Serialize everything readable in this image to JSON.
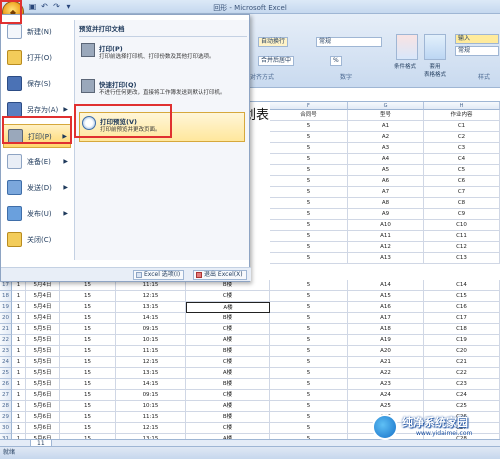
{
  "window": {
    "title": "回形 - Microsoft Excel"
  },
  "ribbon": {
    "wrap_text": "自动换行",
    "number_format": "常规",
    "merge_center": "合并后居中",
    "percent": "%",
    "group_alignment": "对齐方式",
    "group_number": "数字",
    "group_style": "样式",
    "cond_format": "条件格式",
    "table_format": "套用\n表格格式",
    "cell_style": "单元格\n样式",
    "input_label": "输入",
    "normal_label": "常规"
  },
  "menu": {
    "left_items": [
      {
        "label": "新建(N)"
      },
      {
        "label": "打开(O)"
      },
      {
        "label": "保存(S)"
      },
      {
        "label": "另存为(A)"
      },
      {
        "label": "打印(P)"
      },
      {
        "label": "准备(E)"
      },
      {
        "label": "发送(D)"
      },
      {
        "label": "发布(U)"
      },
      {
        "label": "关闭(C)"
      }
    ],
    "right_header": "预览并打印文档",
    "right_items": [
      {
        "title": "打印(P)",
        "desc": "打印前选择打印机、打印份数及其他打印选项。"
      },
      {
        "title": "快速打印(Q)",
        "desc": "不进行任何更改，直接将工作簿发送到默认打印机。"
      },
      {
        "title": "打印预览(V)",
        "desc": "打印前预览并更改页面。"
      }
    ],
    "options_button": "Excel 选项(I)",
    "exit_button": "退出 Excel(X)"
  },
  "sheet": {
    "title_fragment": "划表",
    "col_headers": [
      "",
      "",
      "",
      "",
      "",
      "F",
      "G",
      "H"
    ],
    "header_row": [
      "",
      "",
      "",
      "",
      "",
      "合同号",
      "型号",
      "作业内容"
    ],
    "upper_rows": [
      [
        "5",
        "A1",
        "C1"
      ],
      [
        "5",
        "A2",
        "C2"
      ],
      [
        "5",
        "A3",
        "C3"
      ],
      [
        "5",
        "A4",
        "C4"
      ],
      [
        "5",
        "A5",
        "C5"
      ],
      [
        "5",
        "A6",
        "C6"
      ],
      [
        "5",
        "A7",
        "C7"
      ],
      [
        "5",
        "A8",
        "C8"
      ],
      [
        "5",
        "A9",
        "C9"
      ],
      [
        "5",
        "A10",
        "C10"
      ],
      [
        "5",
        "A11",
        "C11"
      ],
      [
        "5",
        "A12",
        "C12"
      ],
      [
        "5",
        "A13",
        "C13"
      ]
    ],
    "rows": [
      {
        "n": "17",
        "a": "1",
        "b": "5月4日",
        "c": "15",
        "d": "11:15",
        "e": "B楼",
        "f": "5",
        "g": "A14",
        "h": "C14"
      },
      {
        "n": "18",
        "a": "1",
        "b": "5月4日",
        "c": "15",
        "d": "12:15",
        "e": "C楼",
        "f": "5",
        "g": "A15",
        "h": "C15"
      },
      {
        "n": "19",
        "a": "1",
        "b": "5月4日",
        "c": "15",
        "d": "13:15",
        "e": "A楼",
        "f": "5",
        "g": "A16",
        "h": "C16"
      },
      {
        "n": "20",
        "a": "1",
        "b": "5月4日",
        "c": "15",
        "d": "14:15",
        "e": "B楼",
        "f": "5",
        "g": "A17",
        "h": "C17"
      },
      {
        "n": "21",
        "a": "1",
        "b": "5月5日",
        "c": "15",
        "d": "09:15",
        "e": "C楼",
        "f": "5",
        "g": "A18",
        "h": "C18"
      },
      {
        "n": "22",
        "a": "1",
        "b": "5月5日",
        "c": "15",
        "d": "10:15",
        "e": "A楼",
        "f": "5",
        "g": "A19",
        "h": "C19"
      },
      {
        "n": "23",
        "a": "1",
        "b": "5月5日",
        "c": "15",
        "d": "11:15",
        "e": "B楼",
        "f": "5",
        "g": "A20",
        "h": "C20"
      },
      {
        "n": "24",
        "a": "1",
        "b": "5月5日",
        "c": "15",
        "d": "12:15",
        "e": "C楼",
        "f": "5",
        "g": "A21",
        "h": "C21"
      },
      {
        "n": "25",
        "a": "1",
        "b": "5月5日",
        "c": "15",
        "d": "13:15",
        "e": "A楼",
        "f": "5",
        "g": "A22",
        "h": "C22"
      },
      {
        "n": "26",
        "a": "1",
        "b": "5月5日",
        "c": "15",
        "d": "14:15",
        "e": "B楼",
        "f": "5",
        "g": "A23",
        "h": "C23"
      },
      {
        "n": "27",
        "a": "1",
        "b": "5月6日",
        "c": "15",
        "d": "09:15",
        "e": "C楼",
        "f": "5",
        "g": "A24",
        "h": "C24"
      },
      {
        "n": "28",
        "a": "1",
        "b": "5月6日",
        "c": "15",
        "d": "10:15",
        "e": "A楼",
        "f": "5",
        "g": "A25",
        "h": "C25"
      },
      {
        "n": "29",
        "a": "1",
        "b": "5月6日",
        "c": "15",
        "d": "11:15",
        "e": "B楼",
        "f": "5",
        "g": "A26",
        "h": "C26"
      },
      {
        "n": "30",
        "a": "1",
        "b": "5月6日",
        "c": "15",
        "d": "12:15",
        "e": "C楼",
        "f": "5",
        "g": "A27",
        "h": "C27"
      },
      {
        "n": "31",
        "a": "1",
        "b": "5月6日",
        "c": "15",
        "d": "13:15",
        "e": "A楼",
        "f": "5",
        "g": "A28",
        "h": "C28"
      }
    ]
  },
  "sheet_tab": "11",
  "status": "就绪",
  "watermark": {
    "title": "纯净系统家园",
    "url": "www.yidaimei.com"
  }
}
